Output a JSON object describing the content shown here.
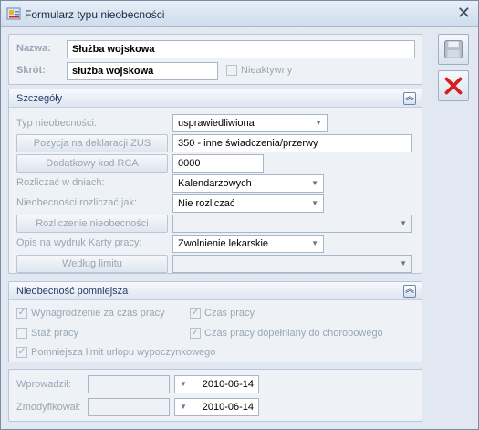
{
  "window": {
    "title": "Formularz typu nieobecności",
    "close_glyph": "✕"
  },
  "header": {
    "nazwa_label": "Nazwa:",
    "nazwa_value": "Służba wojskowa",
    "skrot_label": "Skrót:",
    "skrot_value": "służba wojskowa",
    "nieaktywny_label": "Nieaktywny"
  },
  "toolbar": {
    "save_icon": "floppy-disk-icon",
    "cancel_icon": "red-x-icon"
  },
  "szczegoly": {
    "title": "Szczegóły",
    "collapse_glyph": "︽",
    "typ_label": "Typ nieobecności:",
    "typ_value": "usprawiedliwiona",
    "zus_button": "Pozycja na deklaracji ZUS",
    "zus_value": "350 - inne świadczenia/przerwy",
    "rca_button": "Dodatkowy kod RCA",
    "rca_value": "0000",
    "rozliczac_dni_label": "Rozliczać w dniach:",
    "rozliczac_dni_value": "Kalendarzowych",
    "rozliczac_jak_label": "Nieobecności rozliczać jak:",
    "rozliczac_jak_value": "Nie rozliczać",
    "rozliczenie_button": "Rozliczenie nieobecności",
    "rozliczenie_value": "",
    "opis_label": "Opis na wydruk Karty pracy:",
    "opis_value": "Zwolnienie lekarskie",
    "limit_button": "Według limitu",
    "limit_value": ""
  },
  "pomniejsza": {
    "title": "Nieobecność pomniejsza",
    "collapse_glyph": "︽",
    "items": [
      {
        "label": "Wynagrodzenie za czas pracy",
        "checked": true
      },
      {
        "label": "Czas pracy",
        "checked": true
      },
      {
        "label": "Staż pracy",
        "checked": false
      },
      {
        "label": "Czas pracy dopełniany do chorobowego",
        "checked": true
      },
      {
        "label": "Pomniejsza limit urlopu wypoczynkowego",
        "checked": true
      }
    ]
  },
  "footer": {
    "wprowadzil_label": "Wprowadził:",
    "wprowadzil_user": "",
    "wprowadzil_date": "2010-06-14",
    "zmodyfikowal_label": "Zmodyfikował:",
    "zmodyfikowal_user": "",
    "zmodyfikowal_date": "2010-06-14"
  }
}
